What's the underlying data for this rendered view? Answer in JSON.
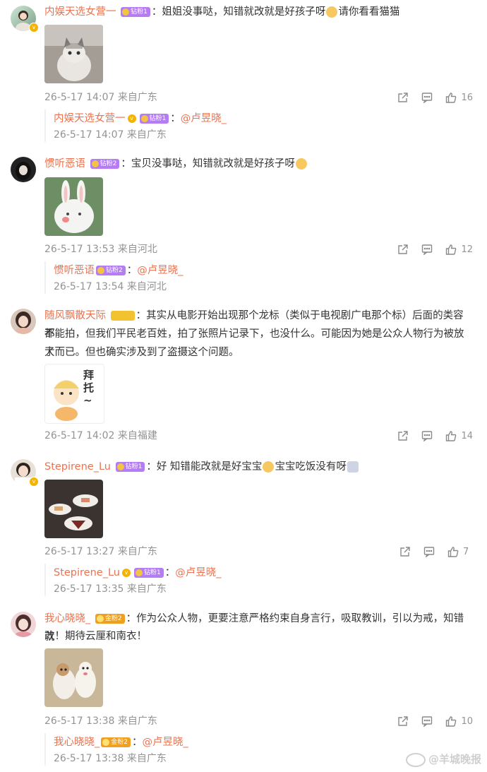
{
  "comments": [
    {
      "user": "内娱天选女营一",
      "level": "钻粉1",
      "text": "姐姐没事哒，知错就改就是好孩子呀",
      "text_after": "请你看看猫猫",
      "meta": "26-5-17 14:07 来自广东",
      "likes": "16",
      "reply": {
        "user": "内娱天选女营一",
        "level": "钻粉1",
        "mention": "@卢昱晓_",
        "meta": "26-5-17 14:07 来自广东"
      }
    },
    {
      "user": "惯听恶语",
      "level": "钻粉2",
      "text": "宝贝没事哒，知错就改就是好孩子呀",
      "meta": "26-5-17 13:53 来自河北",
      "likes": "12",
      "reply": {
        "user": "惯听恶语",
        "level": "钻粉2",
        "mention": "@卢昱晓_",
        "meta": "26-5-17 13:54 来自河北"
      }
    },
    {
      "user": "随风飘散天际",
      "text_l1": "其实从电影开始出现那个龙标（类似于电视剧广电那个标）后面的类容都",
      "text_l2": "不能拍，但我们平民老百姓，拍了张照片记录下，也没什么。可能因为她是公众人物行为被放大",
      "text_l3": "了而已。但也确实涉及到了盗摄这个问题。",
      "sticker_text": "拜托~",
      "meta": "26-5-17 14:02 来自福建",
      "likes": "14"
    },
    {
      "user": "Stepirene_Lu",
      "level": "钻粉1",
      "text": "好 知错能改就是好宝宝",
      "text_after": "宝宝吃饭没有呀",
      "meta": "26-5-17 13:27 来自广东",
      "likes": "7",
      "reply": {
        "user": "Stepirene_Lu",
        "level": "钻粉1",
        "mention": "@卢昱晓_",
        "meta": "26-5-17 13:35 来自广东"
      }
    },
    {
      "user": "我心晓晓_",
      "level": "金粉2",
      "text_l1": "作为公众人物，更要注意严格约束自身言行，吸取教训，引以为戒，知错就",
      "text_l2": "改！期待云厘和南衣！",
      "meta": "26-5-17 13:38 来自广东",
      "likes": "10",
      "reply": {
        "user": "我心晓晓_",
        "level": "金粉2",
        "mention": "@卢昱晓_",
        "meta": "26-5-17 13:38 来自广东"
      }
    }
  ],
  "colon": "：",
  "watermark": "@羊城晚报",
  "icons": [
    "share-icon",
    "comment-icon",
    "like-icon",
    "verified-icon"
  ],
  "colors": {
    "username": "#eb7350",
    "meta": "#939393",
    "text": "#333333"
  }
}
